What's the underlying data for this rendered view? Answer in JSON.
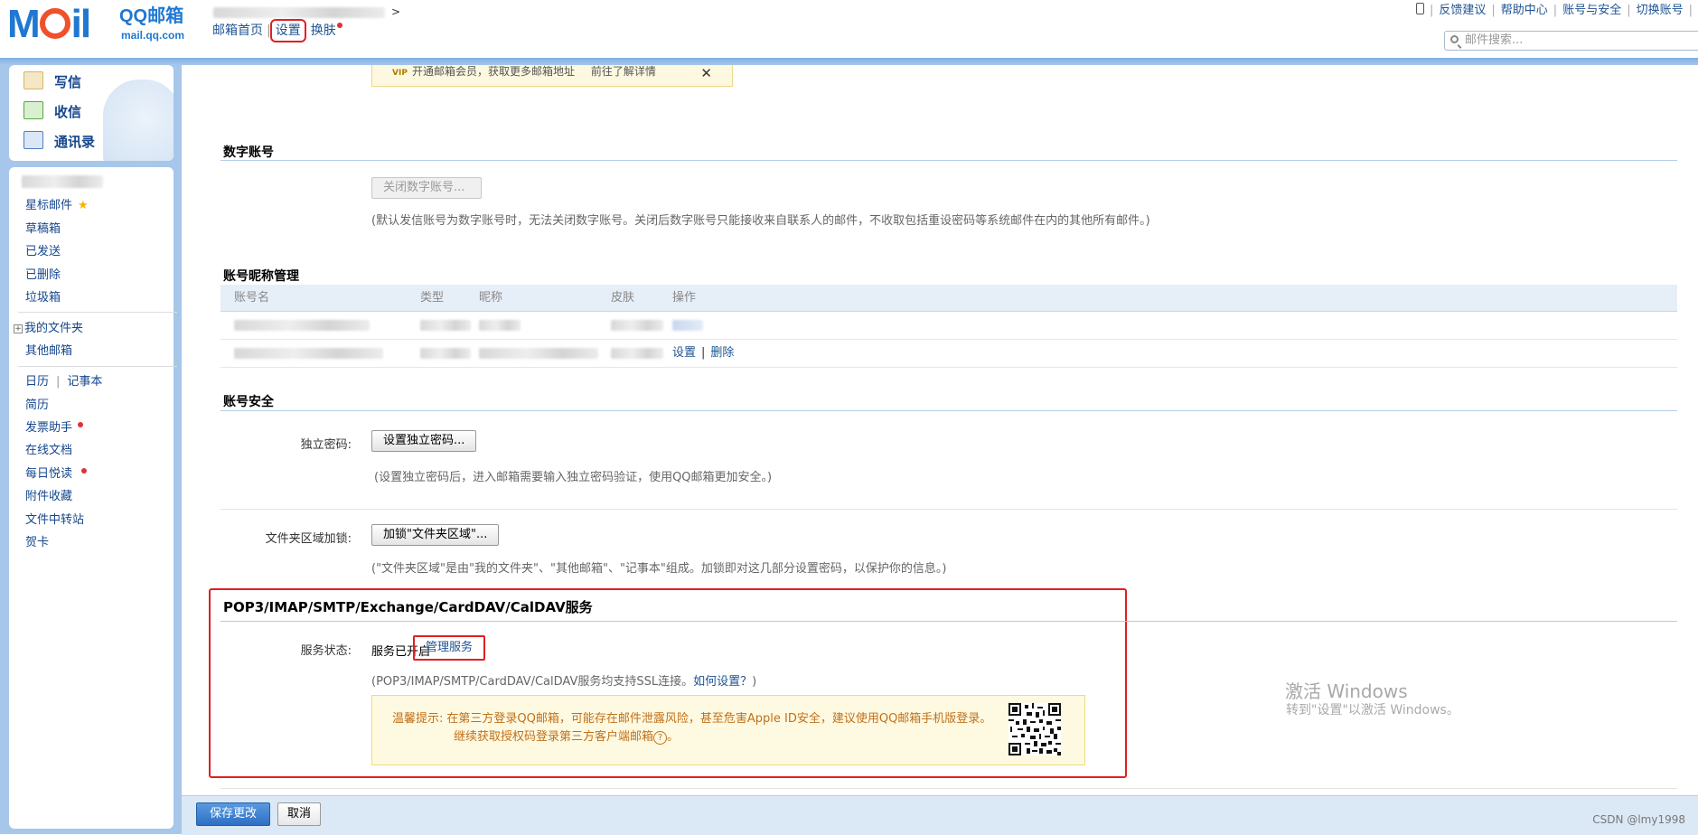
{
  "app": {
    "logo_mail": "MOil",
    "logo_brand": "QQ邮箱",
    "logo_domain": "mail.qq.com"
  },
  "header": {
    "nav": {
      "home": "邮箱首页",
      "settings": "设置",
      "skin": "换肤"
    },
    "toplinks": [
      "反馈建议",
      "帮助中心",
      "账号与安全",
      "切换账号"
    ],
    "search_placeholder": "邮件搜索..."
  },
  "sidebar": {
    "compose": "写信",
    "inbox": "收信",
    "contacts": "通讯录",
    "folders": [
      "星标邮件",
      "草稿箱",
      "已发送",
      "已删除",
      "垃圾箱"
    ],
    "my_folders": "我的文件夹",
    "other_mail": "其他邮箱",
    "calendar": "日历",
    "notes": "记事本",
    "tools": [
      "简历",
      "发票助手",
      "在线文档",
      "每日悦读",
      "附件收藏",
      "文件中转站",
      "贺卡"
    ]
  },
  "main": {
    "vip_banner": {
      "badge": "VIP",
      "text": "开通邮箱会员，获取更多邮箱地址",
      "link": "前往了解详情",
      "close": "✕"
    },
    "digital_account": {
      "title": "数字账号",
      "button": "关闭数字账号...",
      "note": "(默认发信账号为数字账号时，无法关闭数字账号。关闭后数字账号只能接收来自联系人的邮件，不收取包括重设密码等系统邮件在内的其他所有邮件。)"
    },
    "nickname_mgmt": {
      "title": "账号昵称管理",
      "columns": [
        "账号名",
        "类型",
        "昵称",
        "皮肤",
        "操作"
      ],
      "rows": [
        {
          "actions": [
            "设置"
          ]
        },
        {
          "actions": [
            "设置",
            "删除"
          ]
        }
      ]
    },
    "security": {
      "title": "账号安全",
      "password_label": "独立密码:",
      "password_button": "设置独立密码...",
      "password_note": "(设置独立密码后，进入邮箱需要输入独立密码验证，使用QQ邮箱更加安全。)",
      "folder_lock_label": "文件夹区域加锁:",
      "folder_lock_button": "加锁\"文件夹区域\"...",
      "folder_lock_note": "(\"文件夹区域\"是由\"我的文件夹\"、\"其他邮箱\"、\"记事本\"组成。加锁即对这几部分设置密码，以保护你的信息。)"
    },
    "pop3": {
      "title": "POP3/IMAP/SMTP/Exchange/CardDAV/CalDAV服务",
      "status_label": "服务状态:",
      "status_value": "服务已开启",
      "manage_link": "管理服务",
      "ssl_note": "(POP3/IMAP/SMTP/CardDAV/CalDAV服务均支持SSL连接。",
      "howto_link": "如何设置？",
      "ssl_note_end": ")",
      "tip_label": "温馨提示:",
      "tip_line1": "在第三方登录QQ邮箱，可能存在邮件泄露风险，甚至危害Apple ID安全，建议使用QQ邮箱手机版登录。",
      "tip_line2": "继续获取授权码登录第三方客户端邮箱",
      "tip_help": "?"
    }
  },
  "watermark": {
    "line1": "激活 Windows",
    "line2": "转到\"设置\"以激活 Windows。"
  },
  "footer": {
    "save": "保存更改",
    "cancel": "取消",
    "credit": "CSDN @lmy1998"
  },
  "colors": {
    "brand_blue": "#1f78d1",
    "link_blue": "#1e5494",
    "highlight_red": "#e02020",
    "frame_blue": "#a7c7ea"
  }
}
